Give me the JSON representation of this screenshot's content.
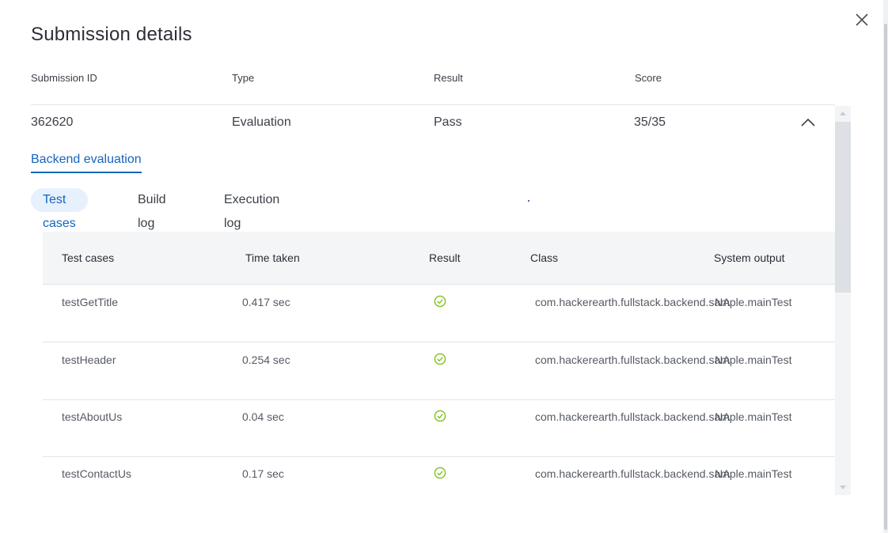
{
  "dialog": {
    "title": "Submission details",
    "close_icon": "close-icon"
  },
  "summary": {
    "headers": [
      "Submission ID",
      "Type",
      "Result",
      "Score"
    ],
    "row": {
      "submission_id": "362620",
      "type": "Evaluation",
      "result": "Pass",
      "score": "35/35"
    },
    "collapse_icon": "chevron-up-icon"
  },
  "section_tab": "Backend evaluation",
  "tabs": [
    "Test cases",
    "Build log",
    "Execution log"
  ],
  "active_tab": "Test cases",
  "table": {
    "headers": [
      "Test cases",
      "Time taken",
      "Result",
      "Class",
      "System output"
    ],
    "rows": [
      {
        "name": "testGetTitle",
        "time": "0.417 sec",
        "result_icon": "check-circle-icon",
        "class": "com.hackerearth.fullstack.backend.sample.mainTest",
        "output": "NA"
      },
      {
        "name": "testHeader",
        "time": "0.254 sec",
        "result_icon": "check-circle-icon",
        "class": "com.hackerearth.fullstack.backend.sample.mainTest",
        "output": "NA"
      },
      {
        "name": "testAboutUs",
        "time": "0.04 sec",
        "result_icon": "check-circle-icon",
        "class": "com.hackerearth.fullstack.backend.sample.mainTest",
        "output": "NA"
      },
      {
        "name": "testContactUs",
        "time": "0.17 sec",
        "result_icon": "check-circle-icon",
        "class": "com.hackerearth.fullstack.backend.sample.mainTest",
        "output": "NA"
      }
    ]
  },
  "colors": {
    "accent": "#1565c0",
    "active_tab_bg": "#e7f1fd",
    "success": "#7cc21b",
    "table_header_bg": "#f4f5f7"
  }
}
